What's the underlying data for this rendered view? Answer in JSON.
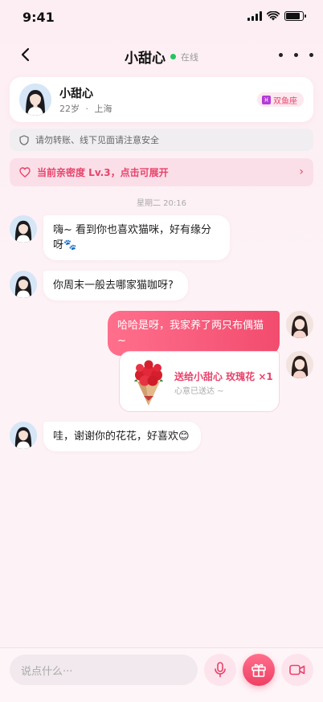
{
  "status_bar": {
    "time": "9:41"
  },
  "nav": {
    "title": "小甜心",
    "online_label": "在线"
  },
  "profile": {
    "name": "小甜心",
    "age": "22岁",
    "separator": "·",
    "city": "上海",
    "zodiac_symbol": "♓",
    "zodiac_label": "双鱼座"
  },
  "safety_notice": "请勿转账、线下见面请注意安全",
  "intimacy": {
    "text": "当前亲密度 Lv.3，点击可展开",
    "arrow": "›"
  },
  "time_separator": "星期二 20:16",
  "messages": [
    {
      "from": "them",
      "text": "嗨~ 看到你也喜欢猫咪，好有缘分呀🐾"
    },
    {
      "from": "them",
      "text": "你周末一般去哪家猫咖呀?"
    },
    {
      "from": "me",
      "text": "哈哈是呀，我家养了两只布偶猫~"
    },
    {
      "from": "me",
      "type": "gift",
      "title": "送给小甜心 玫瑰花 ×1",
      "subtitle": "心意已送达 ~"
    },
    {
      "from": "them",
      "text": "哇，谢谢你的花花，好喜欢😊"
    }
  ],
  "composer": {
    "placeholder": "说点什么···"
  },
  "colors": {
    "accent": "#f24c6e",
    "online": "#22c55e",
    "background": "#fdf0f5"
  },
  "icons": [
    "back-arrow-icon",
    "more-dots-icon",
    "shield-icon",
    "heart-icon",
    "rose-bouquet-icon",
    "mic-icon",
    "gift-icon",
    "video-camera-icon"
  ]
}
